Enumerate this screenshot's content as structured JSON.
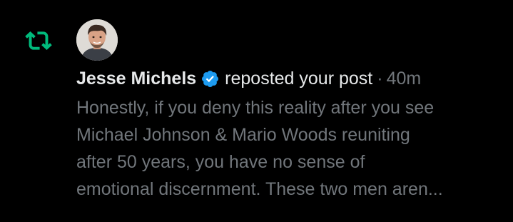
{
  "notification": {
    "author_name": "Jesse Michels",
    "action": "reposted your post",
    "separator": "·",
    "time": "40m",
    "post_lines": [
      "Honestly, if you deny this reality after you see",
      "Michael Johnson & Mario Woods reuniting",
      "after 50 years, you have no sense of",
      "emotional discernment. These two men aren..."
    ],
    "icons": {
      "repost": "repost-icon",
      "verified": "verified-badge-icon",
      "avatar": "avatar"
    },
    "colors": {
      "repost_green": "#00ba7c",
      "verified_blue": "#1d9bf0",
      "primary_text": "#e7e9ea",
      "secondary_text": "#71767b",
      "background": "#000000"
    }
  }
}
